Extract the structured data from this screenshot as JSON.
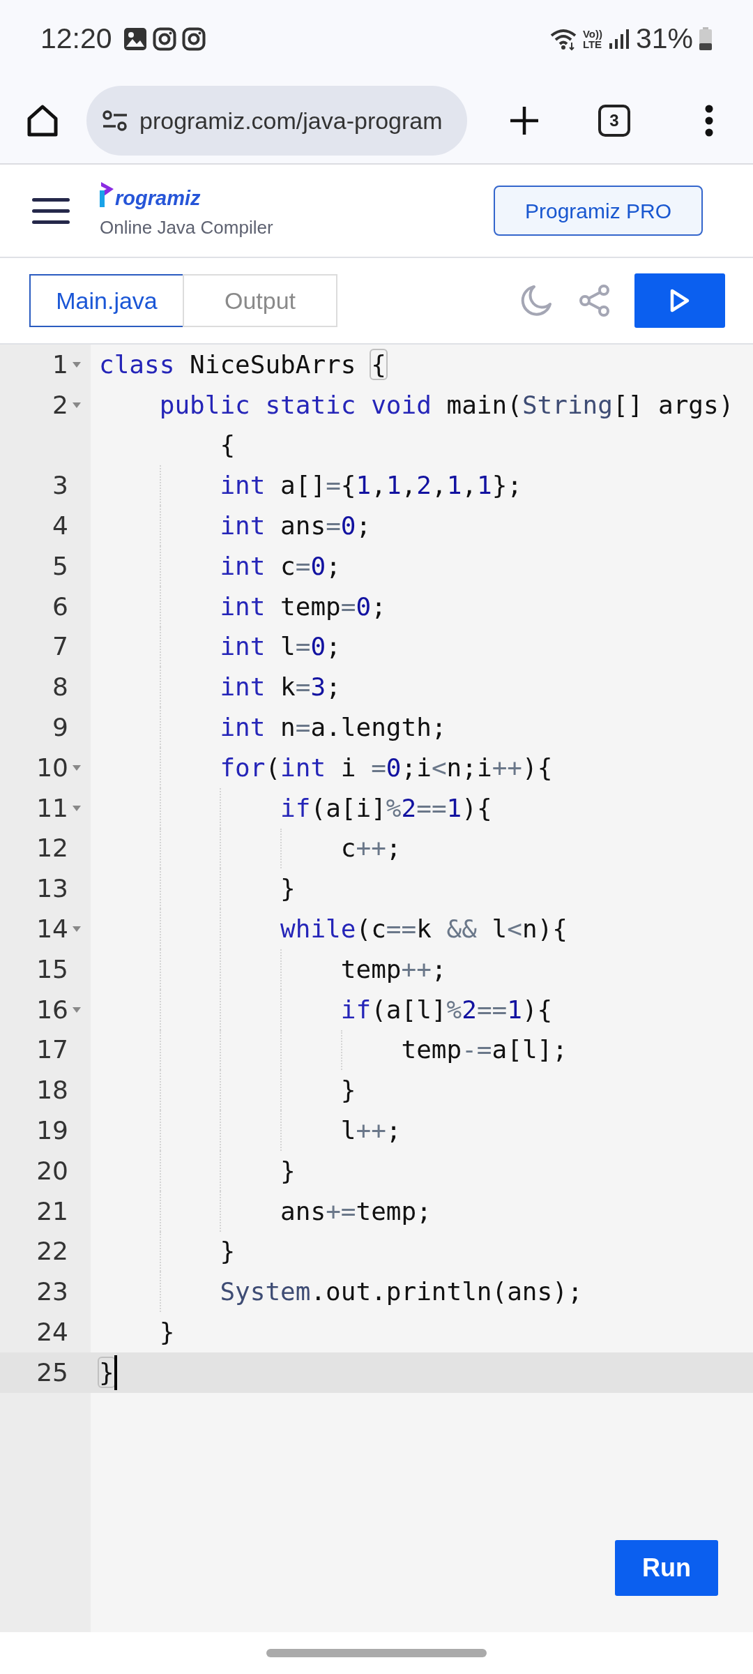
{
  "status_bar": {
    "time": "12:20",
    "volte_top": "Vo))",
    "volte_bottom": "LTE",
    "battery": "31%"
  },
  "browser": {
    "url": "programiz.com/java-program",
    "tab_count": "3"
  },
  "header": {
    "logo_text": "rogramiz",
    "subtitle": "Online Java Compiler",
    "pro_button": "Programiz PRO"
  },
  "tabs": [
    {
      "label": "Main.java",
      "selected": true
    },
    {
      "label": "Output",
      "selected": false
    }
  ],
  "editor": {
    "lines": [
      {
        "number": "1",
        "foldable": true,
        "active": false,
        "tokens": [
          {
            "kind": "keyword",
            "text": "class"
          },
          {
            "kind": "plain",
            "text": " NiceSubArrs "
          },
          {
            "kind": "matched-bracket",
            "text": "{"
          }
        ]
      },
      {
        "number": "2",
        "foldable": true,
        "active": false,
        "tokens": [
          {
            "kind": "keyword",
            "text": "    public static void"
          },
          {
            "kind": "plain",
            "text": " main("
          },
          {
            "kind": "type",
            "text": "String"
          },
          {
            "kind": "plain",
            "text": "[] args)"
          }
        ],
        "continuation": [
          {
            "kind": "plain",
            "text": "        {"
          }
        ]
      },
      {
        "number": "3",
        "foldable": false,
        "active": false,
        "tokens": [
          {
            "kind": "keyword",
            "text": "        int"
          },
          {
            "kind": "plain",
            "text": " a[]"
          },
          {
            "kind": "operator",
            "text": "="
          },
          {
            "kind": "plain",
            "text": "{"
          },
          {
            "kind": "number",
            "text": "1"
          },
          {
            "kind": "plain",
            "text": ","
          },
          {
            "kind": "number",
            "text": "1"
          },
          {
            "kind": "plain",
            "text": ","
          },
          {
            "kind": "number",
            "text": "2"
          },
          {
            "kind": "plain",
            "text": ","
          },
          {
            "kind": "number",
            "text": "1"
          },
          {
            "kind": "plain",
            "text": ","
          },
          {
            "kind": "number",
            "text": "1"
          },
          {
            "kind": "plain",
            "text": "};"
          }
        ]
      },
      {
        "number": "4",
        "foldable": false,
        "active": false,
        "tokens": [
          {
            "kind": "keyword",
            "text": "        int"
          },
          {
            "kind": "plain",
            "text": " ans"
          },
          {
            "kind": "operator",
            "text": "="
          },
          {
            "kind": "number",
            "text": "0"
          },
          {
            "kind": "plain",
            "text": ";"
          }
        ]
      },
      {
        "number": "5",
        "foldable": false,
        "active": false,
        "tokens": [
          {
            "kind": "keyword",
            "text": "        int"
          },
          {
            "kind": "plain",
            "text": " c"
          },
          {
            "kind": "operator",
            "text": "="
          },
          {
            "kind": "number",
            "text": "0"
          },
          {
            "kind": "plain",
            "text": ";"
          }
        ]
      },
      {
        "number": "6",
        "foldable": false,
        "active": false,
        "tokens": [
          {
            "kind": "keyword",
            "text": "        int"
          },
          {
            "kind": "plain",
            "text": " temp"
          },
          {
            "kind": "operator",
            "text": "="
          },
          {
            "kind": "number",
            "text": "0"
          },
          {
            "kind": "plain",
            "text": ";"
          }
        ]
      },
      {
        "number": "7",
        "foldable": false,
        "active": false,
        "tokens": [
          {
            "kind": "keyword",
            "text": "        int"
          },
          {
            "kind": "plain",
            "text": " l"
          },
          {
            "kind": "operator",
            "text": "="
          },
          {
            "kind": "number",
            "text": "0"
          },
          {
            "kind": "plain",
            "text": ";"
          }
        ]
      },
      {
        "number": "8",
        "foldable": false,
        "active": false,
        "tokens": [
          {
            "kind": "keyword",
            "text": "        int"
          },
          {
            "kind": "plain",
            "text": " k"
          },
          {
            "kind": "operator",
            "text": "="
          },
          {
            "kind": "number",
            "text": "3"
          },
          {
            "kind": "plain",
            "text": ";"
          }
        ]
      },
      {
        "number": "9",
        "foldable": false,
        "active": false,
        "tokens": [
          {
            "kind": "keyword",
            "text": "        int"
          },
          {
            "kind": "plain",
            "text": " n"
          },
          {
            "kind": "operator",
            "text": "="
          },
          {
            "kind": "plain",
            "text": "a.length;"
          }
        ]
      },
      {
        "number": "10",
        "foldable": true,
        "active": false,
        "tokens": [
          {
            "kind": "keyword",
            "text": "        for"
          },
          {
            "kind": "plain",
            "text": "("
          },
          {
            "kind": "keyword",
            "text": "int"
          },
          {
            "kind": "plain",
            "text": " i "
          },
          {
            "kind": "operator",
            "text": "="
          },
          {
            "kind": "number",
            "text": "0"
          },
          {
            "kind": "plain",
            "text": ";i"
          },
          {
            "kind": "operator",
            "text": "<"
          },
          {
            "kind": "plain",
            "text": "n;i"
          },
          {
            "kind": "operator",
            "text": "++"
          },
          {
            "kind": "plain",
            "text": "){"
          }
        ]
      },
      {
        "number": "11",
        "foldable": true,
        "active": false,
        "tokens": [
          {
            "kind": "keyword",
            "text": "            if"
          },
          {
            "kind": "plain",
            "text": "(a[i]"
          },
          {
            "kind": "operator",
            "text": "%"
          },
          {
            "kind": "number",
            "text": "2"
          },
          {
            "kind": "operator",
            "text": "=="
          },
          {
            "kind": "number",
            "text": "1"
          },
          {
            "kind": "plain",
            "text": "){"
          }
        ]
      },
      {
        "number": "12",
        "foldable": false,
        "active": false,
        "tokens": [
          {
            "kind": "plain",
            "text": "                c"
          },
          {
            "kind": "operator",
            "text": "++"
          },
          {
            "kind": "plain",
            "text": ";"
          }
        ]
      },
      {
        "number": "13",
        "foldable": false,
        "active": false,
        "tokens": [
          {
            "kind": "plain",
            "text": "            }"
          }
        ]
      },
      {
        "number": "14",
        "foldable": true,
        "active": false,
        "tokens": [
          {
            "kind": "keyword",
            "text": "            while"
          },
          {
            "kind": "plain",
            "text": "(c"
          },
          {
            "kind": "operator",
            "text": "=="
          },
          {
            "kind": "plain",
            "text": "k "
          },
          {
            "kind": "operator",
            "text": "&&"
          },
          {
            "kind": "plain",
            "text": " l"
          },
          {
            "kind": "operator",
            "text": "<"
          },
          {
            "kind": "plain",
            "text": "n){"
          }
        ]
      },
      {
        "number": "15",
        "foldable": false,
        "active": false,
        "tokens": [
          {
            "kind": "plain",
            "text": "                temp"
          },
          {
            "kind": "operator",
            "text": "++"
          },
          {
            "kind": "plain",
            "text": ";"
          }
        ]
      },
      {
        "number": "16",
        "foldable": true,
        "active": false,
        "tokens": [
          {
            "kind": "keyword",
            "text": "                if"
          },
          {
            "kind": "plain",
            "text": "(a[l]"
          },
          {
            "kind": "operator",
            "text": "%"
          },
          {
            "kind": "number",
            "text": "2"
          },
          {
            "kind": "operator",
            "text": "=="
          },
          {
            "kind": "number",
            "text": "1"
          },
          {
            "kind": "plain",
            "text": "){"
          }
        ]
      },
      {
        "number": "17",
        "foldable": false,
        "active": false,
        "tokens": [
          {
            "kind": "plain",
            "text": "                    temp"
          },
          {
            "kind": "operator",
            "text": "-="
          },
          {
            "kind": "plain",
            "text": "a[l];"
          }
        ]
      },
      {
        "number": "18",
        "foldable": false,
        "active": false,
        "tokens": [
          {
            "kind": "plain",
            "text": "                }"
          }
        ]
      },
      {
        "number": "19",
        "foldable": false,
        "active": false,
        "tokens": [
          {
            "kind": "plain",
            "text": "                l"
          },
          {
            "kind": "operator",
            "text": "++"
          },
          {
            "kind": "plain",
            "text": ";"
          }
        ]
      },
      {
        "number": "20",
        "foldable": false,
        "active": false,
        "tokens": [
          {
            "kind": "plain",
            "text": "            }"
          }
        ]
      },
      {
        "number": "21",
        "foldable": false,
        "active": false,
        "tokens": [
          {
            "kind": "plain",
            "text": "            ans"
          },
          {
            "kind": "operator",
            "text": "+="
          },
          {
            "kind": "plain",
            "text": "temp;"
          }
        ]
      },
      {
        "number": "22",
        "foldable": false,
        "active": false,
        "tokens": [
          {
            "kind": "plain",
            "text": "        }"
          }
        ]
      },
      {
        "number": "23",
        "foldable": false,
        "active": false,
        "tokens": [
          {
            "kind": "type",
            "text": "        System"
          },
          {
            "kind": "plain",
            "text": ".out.println(ans);"
          }
        ]
      },
      {
        "number": "24",
        "foldable": false,
        "active": false,
        "tokens": [
          {
            "kind": "plain",
            "text": "    }"
          }
        ]
      },
      {
        "number": "25",
        "foldable": false,
        "active": true,
        "tokens": [
          {
            "kind": "matched-bracket",
            "text": "}"
          }
        ]
      }
    ]
  },
  "run_button": "Run"
}
